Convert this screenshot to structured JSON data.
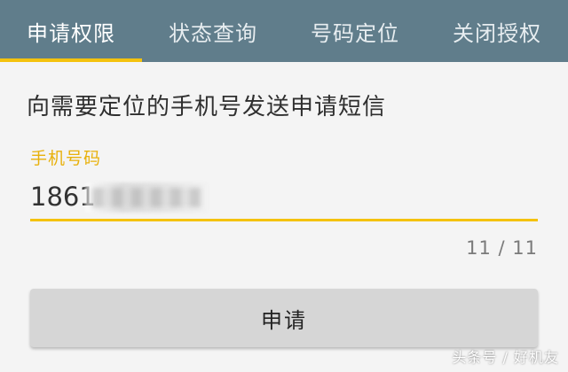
{
  "tabs": [
    {
      "label": "申请权限",
      "active": true
    },
    {
      "label": "状态查询",
      "active": false
    },
    {
      "label": "号码定位",
      "active": false
    },
    {
      "label": "关闭授权",
      "active": false
    }
  ],
  "instruction": "向需要定位的手机号发送申请短信",
  "phone_field": {
    "label": "手机号码",
    "value": "1861",
    "counter": "11 / 11"
  },
  "apply_button": {
    "label": "申请"
  },
  "watermark": "头条号 / 好机友",
  "colors": {
    "tab_bar": "#607d8b",
    "accent": "#f4c20d",
    "button": "#d6d6d6",
    "background": "#f4f4f4"
  }
}
